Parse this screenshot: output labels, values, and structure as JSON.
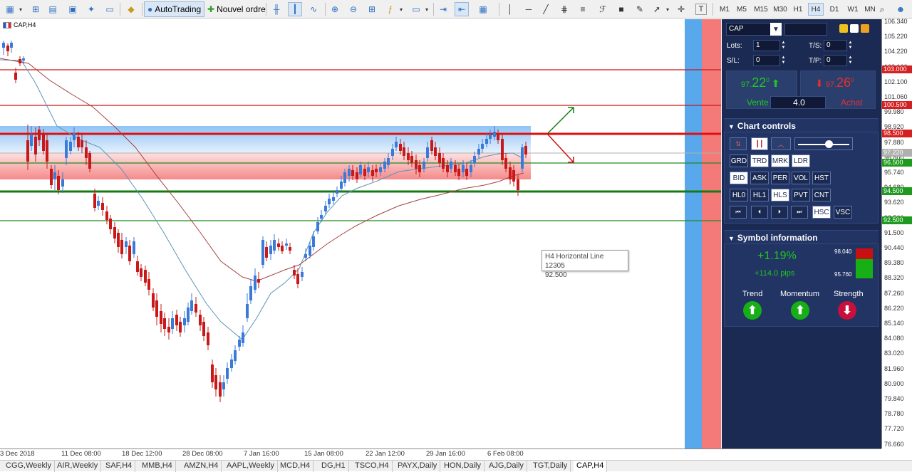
{
  "toolbar": {
    "autotrading_label": "AutoTrading",
    "new_order_label": "Nouvel ordre",
    "timeframes": [
      "M1",
      "M5",
      "M15",
      "M30",
      "H1",
      "H4",
      "D1",
      "W1",
      "MN"
    ],
    "active_timeframe": "H4",
    "text_tool_label": "T"
  },
  "chart": {
    "symbol_label": "CAP,H4",
    "tooltip": {
      "line1": "H4 Horizontal Line 12305",
      "line2": "92.500"
    },
    "price_labels": [
      "106.340",
      "105.220",
      "104.220",
      "103.160",
      "102.100",
      "101.060",
      "99.980",
      "98.920",
      "97.880",
      "96.800",
      "95.740",
      "94.680",
      "93.620",
      "92.560",
      "91.500",
      "90.440",
      "89.380",
      "88.320",
      "87.260",
      "86.220",
      "85.140",
      "84.080",
      "83.020",
      "81.960",
      "80.900",
      "79.840",
      "78.780",
      "77.720",
      "76.660"
    ],
    "price_badges": [
      {
        "value": "103.000",
        "color": "#d42020"
      },
      {
        "value": "100.500",
        "color": "#d42020"
      },
      {
        "value": "98.500",
        "color": "#d42020"
      },
      {
        "value": "97.220",
        "color": "#b0b0b0"
      },
      {
        "value": "96.500",
        "color": "#1e9a1e"
      },
      {
        "value": "94.500",
        "color": "#1e9a1e"
      },
      {
        "value": "92.500",
        "color": "#1e9a1e"
      }
    ],
    "time_labels": [
      "3 Dec 2018",
      "11 Dec 08:00",
      "18 Dec 12:00",
      "28 Dec 08:00",
      "7 Jan 16:00",
      "15 Jan 08:00",
      "22 Jan 12:00",
      "29 Jan 16:00",
      "6 Feb 08:00"
    ]
  },
  "tabs": [
    "CGG,Weekly",
    "AIR,Weekly",
    "SAF,H4",
    "MMB,H4",
    "AMZN,H4",
    "AAPL,Weekly",
    "MCD,H4",
    "DG,H1",
    "TSCO,H4",
    "PAYX,Daily",
    "HON,Daily",
    "AJG,Daily",
    "TGT,Daily",
    "CAP,H4"
  ],
  "active_tab": "CAP,H4",
  "panel": {
    "symbol": "CAP",
    "lots_label": "Lots:",
    "lots_value": "1",
    "ts_label": "T/S:",
    "ts_value": "0",
    "sl_label": "S/L:",
    "sl_value": "0",
    "tp_label": "T/P:",
    "tp_value": "0",
    "sell_price_small": "97.",
    "sell_price_big": "22",
    "sell_price_sup": "0",
    "buy_price_small": "97.",
    "buy_price_big": "26",
    "buy_price_sup": "0",
    "sell_label": "Vente",
    "buy_label": "Achat",
    "spread": "4.0",
    "chart_controls_title": "Chart controls",
    "row1": [
      "GRD",
      "TRD",
      "MRK",
      "LDR"
    ],
    "row2": [
      "BID",
      "ASK",
      "PER",
      "VOL",
      "HST"
    ],
    "row3": [
      "HL0",
      "HL1",
      "HLS",
      "PVT",
      "CNT"
    ],
    "row4_extra": [
      "HSC",
      "VSC"
    ],
    "symbol_info_title": "Symbol information",
    "change_pct": "+1.19%",
    "change_pips": "+114.0 pips",
    "range_high": "98.040",
    "range_low": "95.760",
    "trend_label": "Trend",
    "momentum_label": "Momentum",
    "strength_label": "Strength",
    "colors": {
      "up": "#16b016",
      "down": "#c8103c",
      "panel_bg": "#1b2a52"
    }
  }
}
